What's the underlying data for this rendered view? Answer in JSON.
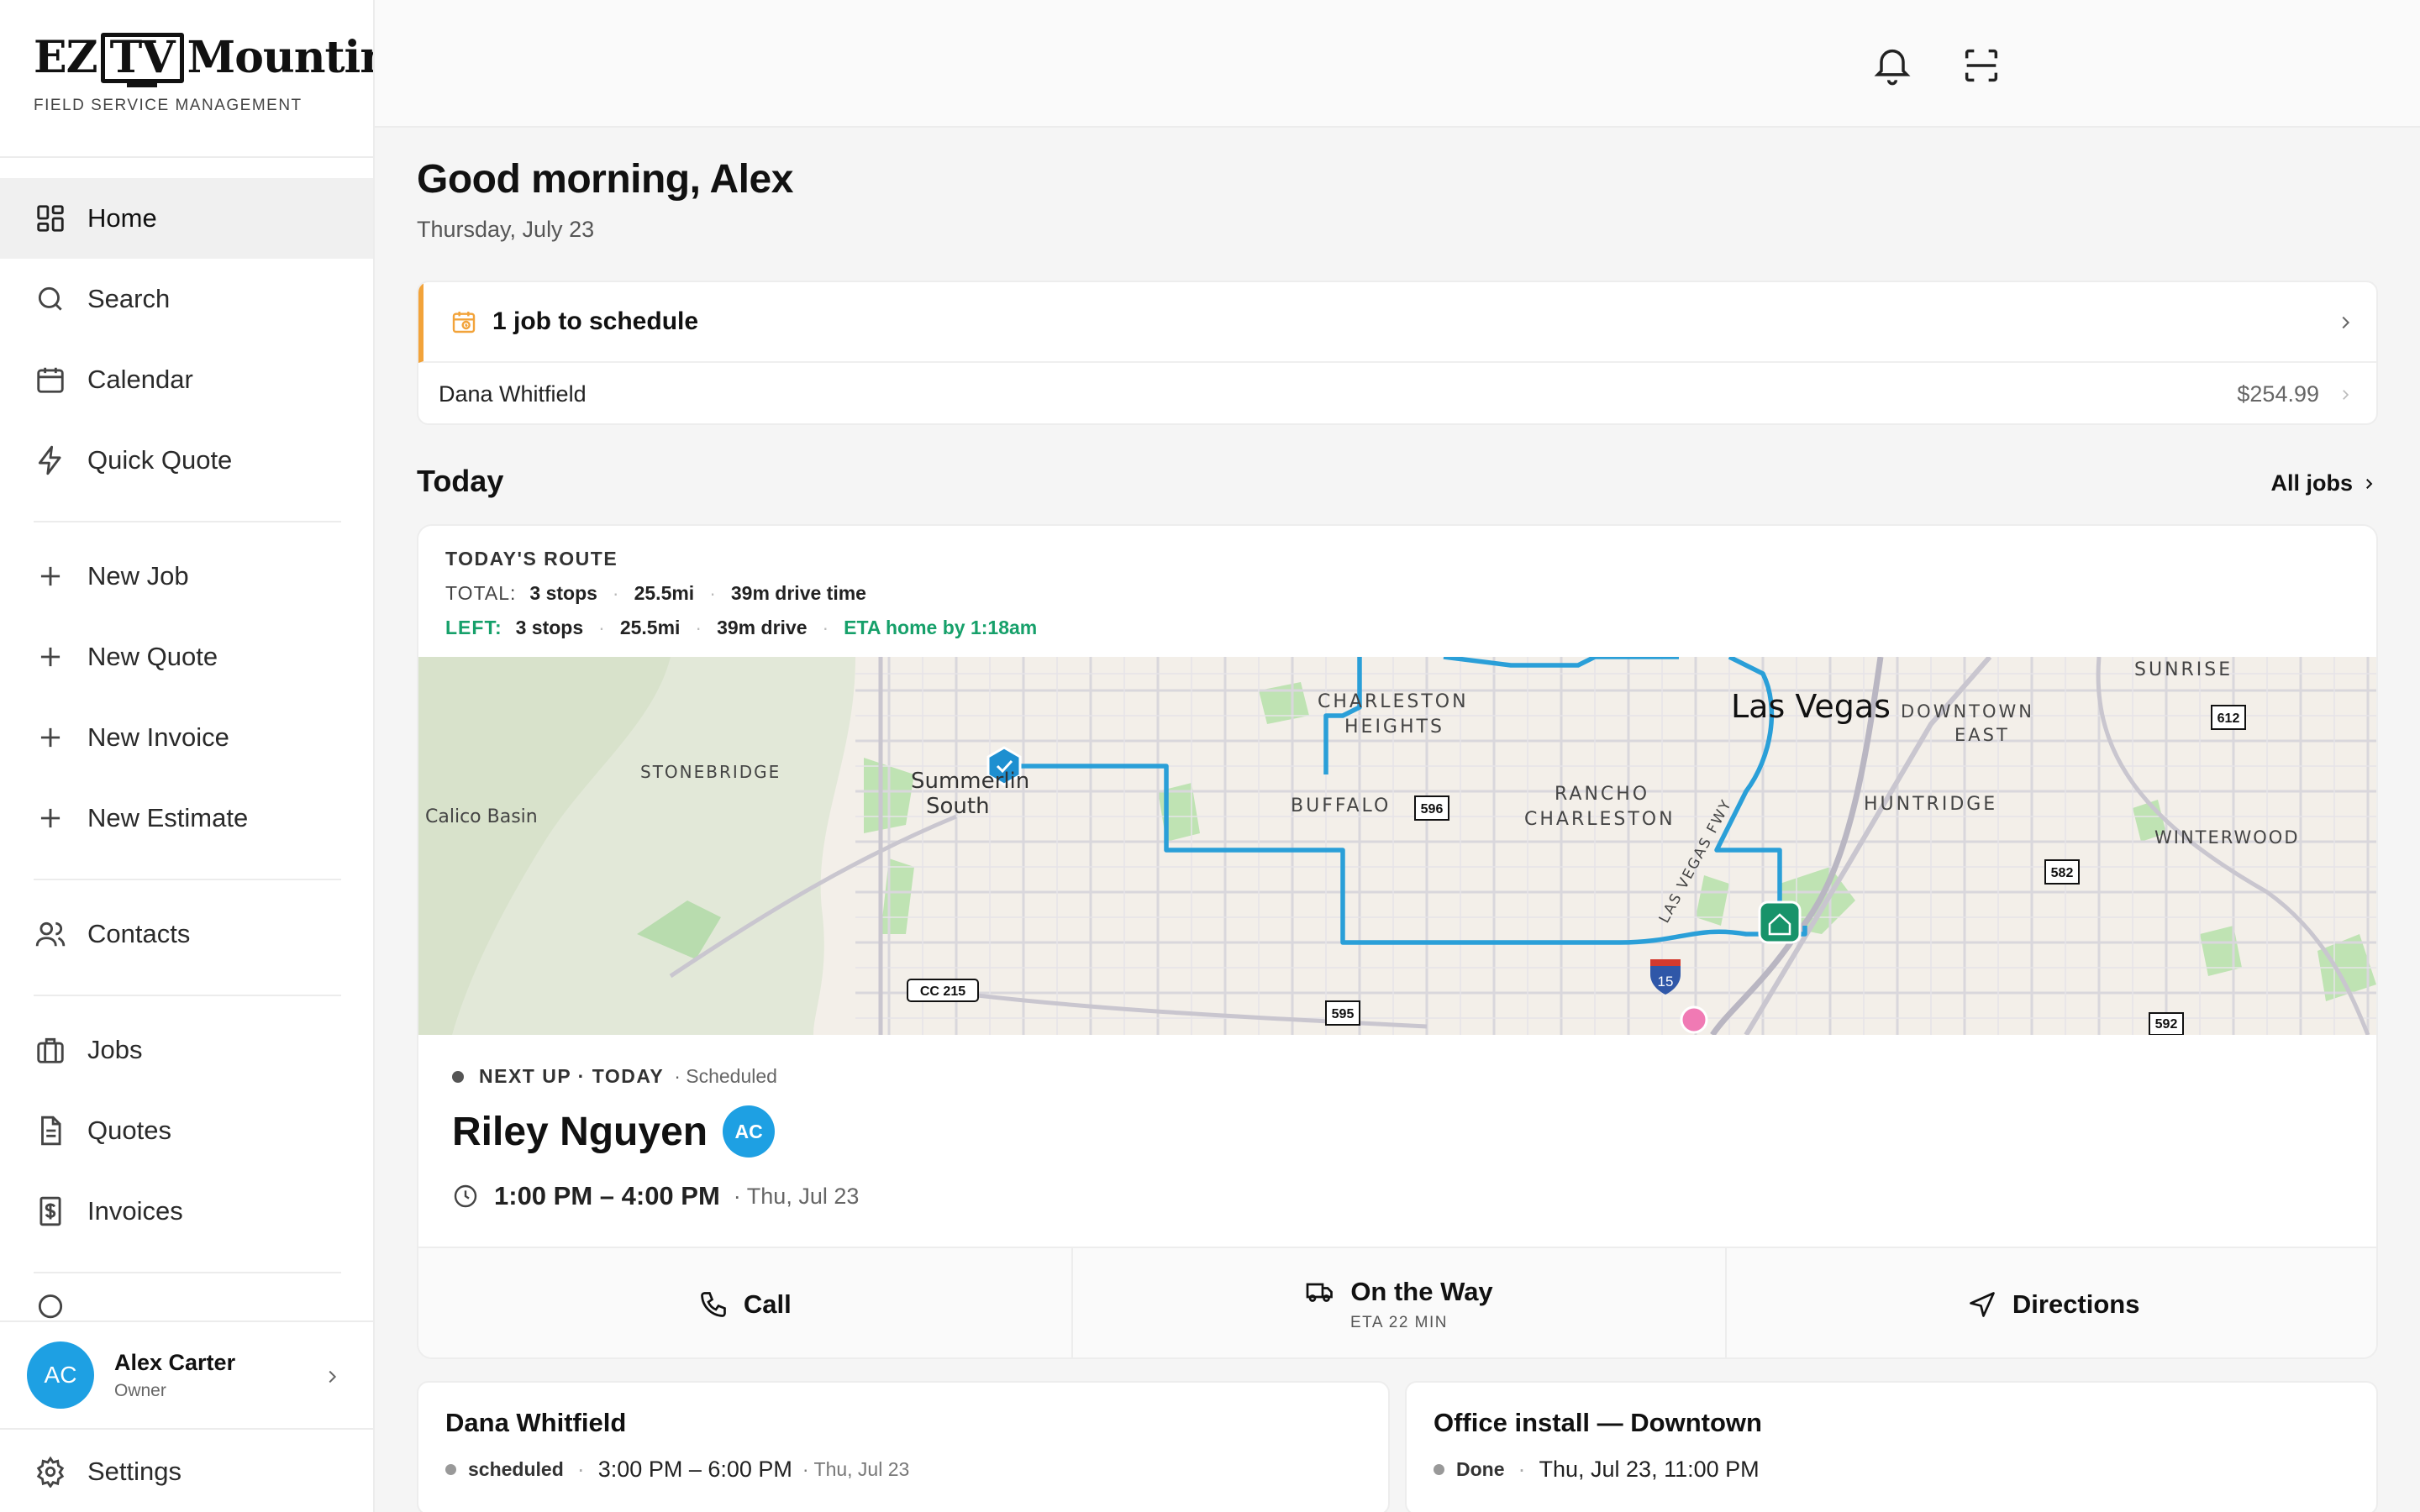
{
  "brand": {
    "logo_left": "EZ",
    "logo_box": "TV",
    "logo_right": "Mounting",
    "subtitle": "FIELD SERVICE MANAGEMENT"
  },
  "nav": {
    "home": "Home",
    "search": "Search",
    "calendar": "Calendar",
    "quick_quote": "Quick Quote",
    "new_job": "New Job",
    "new_quote": "New Quote",
    "new_invoice": "New Invoice",
    "new_estimate": "New Estimate",
    "contacts": "Contacts",
    "jobs": "Jobs",
    "quotes": "Quotes",
    "invoices": "Invoices",
    "settings": "Settings"
  },
  "user": {
    "initials": "AC",
    "name": "Alex Carter",
    "role": "Owner"
  },
  "header": {
    "greeting": "Good morning, Alex",
    "date": "Thursday, July 23"
  },
  "to_schedule": {
    "title": "1 job to schedule",
    "customer": "Dana Whitfield",
    "amount": "$254.99"
  },
  "today": {
    "title": "Today",
    "all_jobs": "All jobs"
  },
  "route": {
    "label": "TODAY'S ROUTE",
    "total_key": "TOTAL:",
    "total_stops": "3 stops",
    "total_miles": "25.5mi",
    "total_drive": "39m drive time",
    "left_key": "LEFT:",
    "left_stops": "3 stops",
    "left_miles": "25.5mi",
    "left_drive": "39m drive",
    "eta_home": "ETA home by 1:18am"
  },
  "map": {
    "labels": {
      "calico": "Calico Basin",
      "stonebridge": "STONEBRIDGE",
      "summerlin1": "Summerlin",
      "summerlin2": "South",
      "charleston1": "CHARLESTON",
      "charleston2": "HEIGHTS",
      "buffalo": "BUFFALO",
      "rancho1": "RANCHO",
      "rancho2": "CHARLESTON",
      "lasvegas": "Las Vegas",
      "downtown1": "DOWNTOWN",
      "downtown2": "EAST",
      "huntridge": "HUNTRIDGE",
      "sunrise": "SUNRISE",
      "winterwood": "WINTERWOOD",
      "fwy": "LAS VEGAS FWY",
      "r596": "596",
      "r612": "612",
      "r582": "582",
      "r595": "595",
      "r592": "592",
      "cc215": "CC 215",
      "i15": "15"
    }
  },
  "next_job": {
    "next_up": "NEXT UP · TODAY",
    "status": "· Scheduled",
    "customer": "Riley Nguyen",
    "assignee": "AC",
    "time": "1:00 PM – 4:00 PM",
    "date": "· Thu, Jul 23"
  },
  "actions": {
    "call": "Call",
    "on_the_way": "On the Way",
    "eta": "ETA 22 MIN",
    "directions": "Directions"
  },
  "jobs_list": [
    {
      "title": "Dana Whitfield",
      "status": "scheduled",
      "time": "3:00 PM – 6:00 PM",
      "date": "· Thu, Jul 23"
    },
    {
      "title": "Office install — Downtown",
      "status": "Done",
      "time": "Thu, Jul 23, 11:00 PM",
      "date": ""
    }
  ],
  "colors": {
    "accent_blue": "#1ea0e3",
    "route_blue": "#2a9fd8",
    "eta_green": "#16a06a",
    "schedule_orange": "#f2a33a"
  }
}
